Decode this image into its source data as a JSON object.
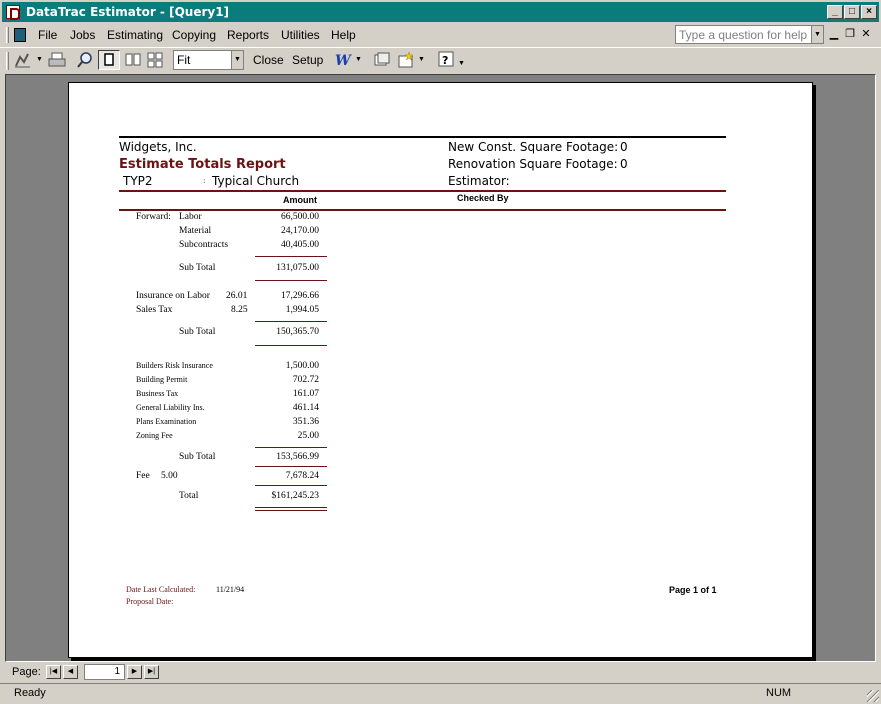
{
  "window": {
    "title": "DataTrac Estimator - [Query1]"
  },
  "menu": {
    "items": [
      {
        "label": "File"
      },
      {
        "label": "Jobs"
      },
      {
        "label": "Estimating"
      },
      {
        "label": "Copying"
      },
      {
        "label": "Reports"
      },
      {
        "label": "Utilities"
      },
      {
        "label": "Help"
      }
    ],
    "help_placeholder": "Type a question for help"
  },
  "toolbar": {
    "zoom_value": "Fit",
    "close_label": "Close",
    "setup_label": "Setup"
  },
  "report": {
    "company": "Widgets, Inc.",
    "title": "Estimate Totals Report",
    "job_code": "TYP2",
    "job_name": "Typical Church",
    "new_const_label": "New Const. Square Footage:",
    "new_const_value": "0",
    "reno_label": "Renovation Square Footage:",
    "reno_value": "0",
    "estimator_label": "Estimator:",
    "amount_header": "Amount",
    "checked_by": "Checked By",
    "forward_label": "Forward:",
    "labor_label": "Labor",
    "labor_value": "66,500.00",
    "material_label": "Material",
    "material_value": "24,170.00",
    "subcontracts_label": "Subcontracts",
    "subcontracts_value": "40,405.00",
    "subtotal_label": "Sub Total",
    "subtotal1": "131,075.00",
    "ins_label": "Insurance on Labor",
    "ins_rate": "26.01",
    "ins_value": "17,296.66",
    "sales_label": "Sales Tax",
    "sales_rate": "8.25",
    "sales_value": "1,994.05",
    "subtotal2": "150,365.70",
    "items": [
      {
        "label": "Builders Risk Insurance",
        "value": "1,500.00"
      },
      {
        "label": "Building Permit",
        "value": "702.72"
      },
      {
        "label": "Business Tax",
        "value": "161.07"
      },
      {
        "label": "General Liability Ins.",
        "value": "461.14"
      },
      {
        "label": "Plans Examination",
        "value": "351.36"
      },
      {
        "label": "Zoning Fee",
        "value": "25.00"
      }
    ],
    "subtotal3": "153,566.99",
    "fee_label": "Fee",
    "fee_rate": "5.00",
    "fee_value": "7,678.24",
    "total_label": "Total",
    "total_value": "$161,245.23",
    "date_calc_label": "Date Last Calculated:",
    "date_calc_value": "11/21/94",
    "proposal_label": "Proposal Date:",
    "page_label": "Page 1 of 1"
  },
  "nav": {
    "page_label": "Page:",
    "page_value": "1"
  },
  "status": {
    "ready": "Ready",
    "num": "NUM"
  }
}
